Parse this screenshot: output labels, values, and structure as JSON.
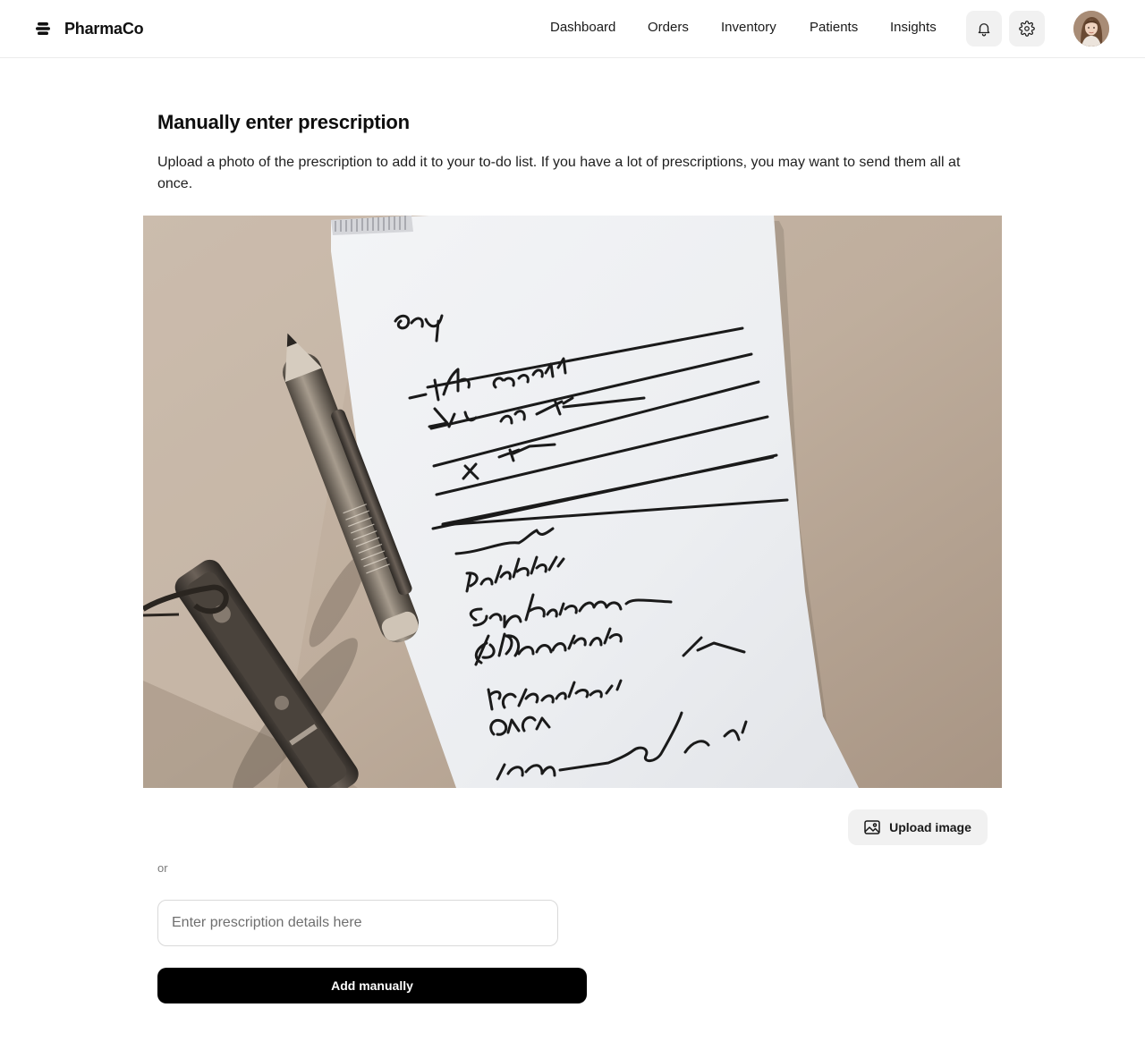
{
  "app": {
    "name": "PharmaCo"
  },
  "nav": {
    "items": [
      {
        "label": "Dashboard"
      },
      {
        "label": "Orders"
      },
      {
        "label": "Inventory"
      },
      {
        "label": "Patients"
      },
      {
        "label": "Insights"
      }
    ]
  },
  "header_icons": {
    "notifications": "bell-icon",
    "settings": "gear-icon"
  },
  "main": {
    "title": "Manually enter prescription",
    "description": "Upload a photo of the prescription to add it to your to-do list. If you have a lot of prescriptions, you may want to send them all at once.",
    "upload_label": "Upload image",
    "or_label": "or",
    "input_value": "",
    "input_placeholder": "Enter prescription details here",
    "add_label": "Add manually"
  },
  "colors": {
    "primary_button": "#000000",
    "secondary_button": "#f1f1f1",
    "border": "#d9d9d9"
  }
}
